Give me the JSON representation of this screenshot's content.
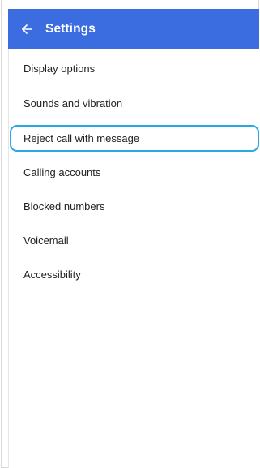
{
  "header": {
    "title": "Settings",
    "back_icon": "arrow-left-icon",
    "background_color": "#3b6de0"
  },
  "settings_list": {
    "items": [
      {
        "label": "Display options"
      },
      {
        "label": "Sounds and vibration"
      },
      {
        "label": "Reject call with message",
        "highlighted": true
      },
      {
        "label": "Calling accounts"
      },
      {
        "label": "Blocked numbers"
      },
      {
        "label": "Voicemail"
      },
      {
        "label": "Accessibility"
      }
    ],
    "highlight_color": "#2aa7e6"
  }
}
